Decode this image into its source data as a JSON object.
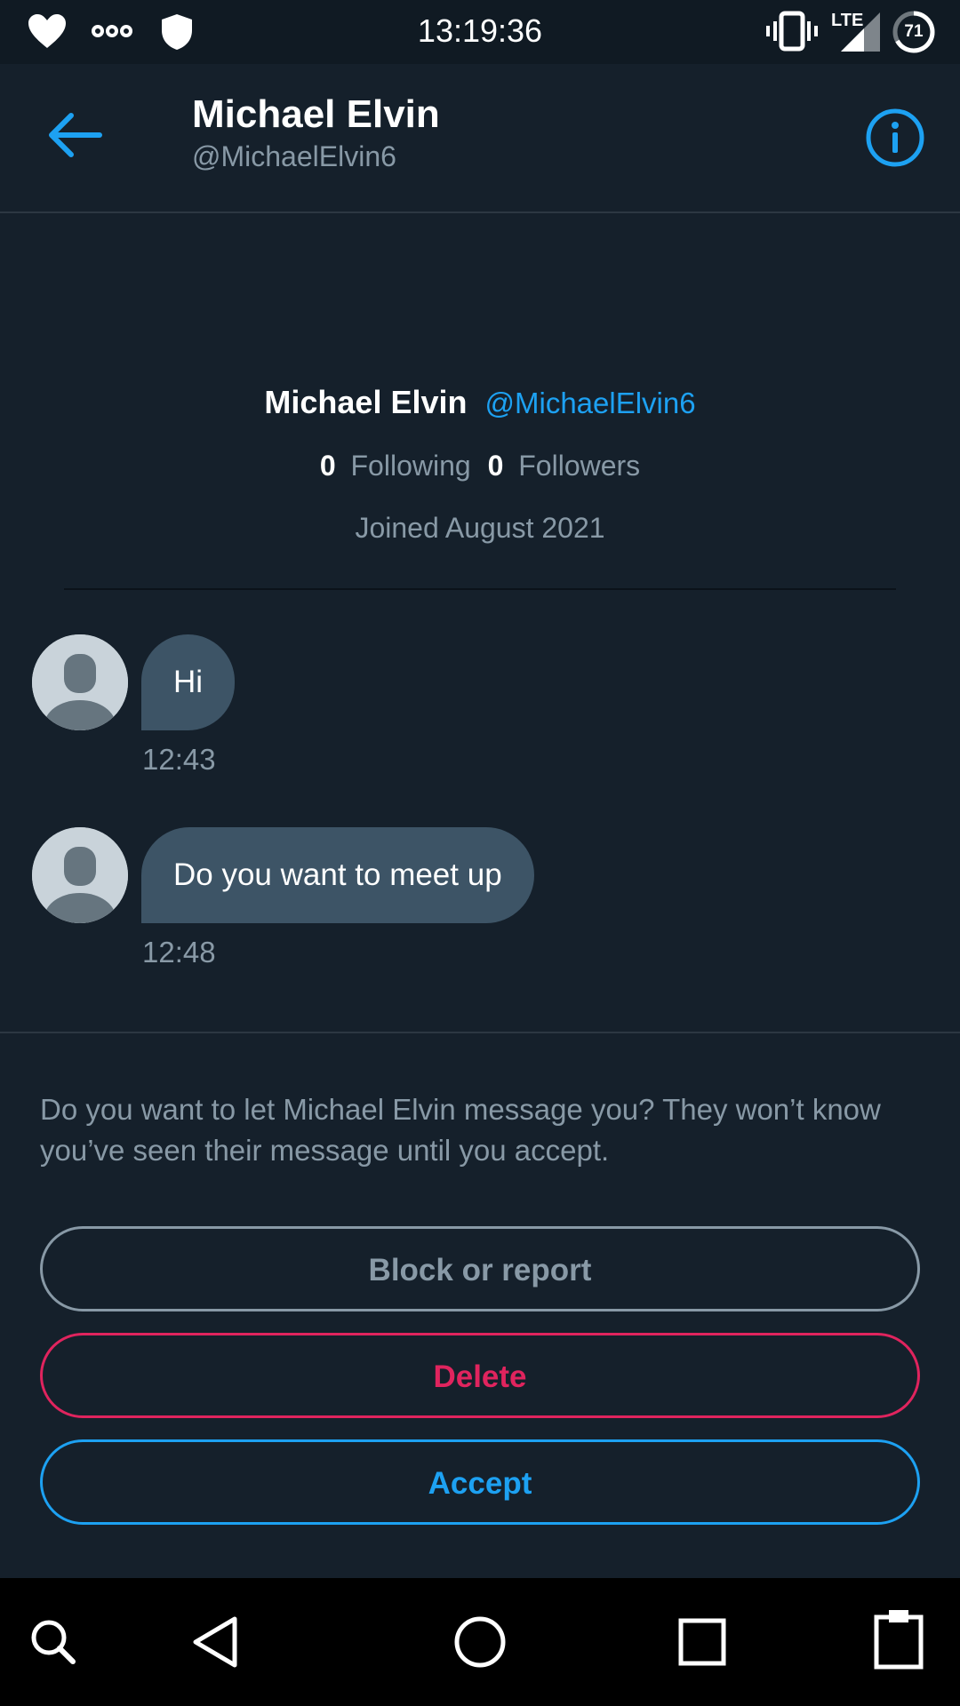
{
  "status_bar": {
    "time": "13:19:36",
    "network_label": "LTE",
    "battery_level": "71",
    "icons": [
      "heart-icon",
      "infinity-icon",
      "shield-icon",
      "vibrate-icon",
      "signal-icon",
      "battery-icon"
    ]
  },
  "header": {
    "name": "Michael Elvin",
    "handle": "@MichaelElvin6",
    "back_icon": "arrow-left-icon",
    "info_icon": "info-icon"
  },
  "profile": {
    "name": "Michael Elvin",
    "handle": "@MichaelElvin6",
    "following_count": "0",
    "following_label": "Following",
    "followers_count": "0",
    "followers_label": "Followers",
    "joined": "Joined August 2021"
  },
  "messages": [
    {
      "text": "Hi",
      "time": "12:43"
    },
    {
      "text": "Do you want to meet up",
      "time": "12:48"
    }
  ],
  "request": {
    "prompt": "Do you want to let Michael Elvin message you? They won’t know you’ve seen their message until you accept.",
    "block_label": "Block or report",
    "delete_label": "Delete",
    "accept_label": "Accept"
  },
  "nav_bar": {
    "icons": [
      "search-icon",
      "back-triangle-icon",
      "home-circle-icon",
      "recents-square-icon",
      "clipboard-icon"
    ]
  },
  "colors": {
    "background": "#15202b",
    "accent": "#1da1f2",
    "danger": "#e0245e",
    "muted": "#8899a6",
    "bubble": "#3d5466"
  }
}
